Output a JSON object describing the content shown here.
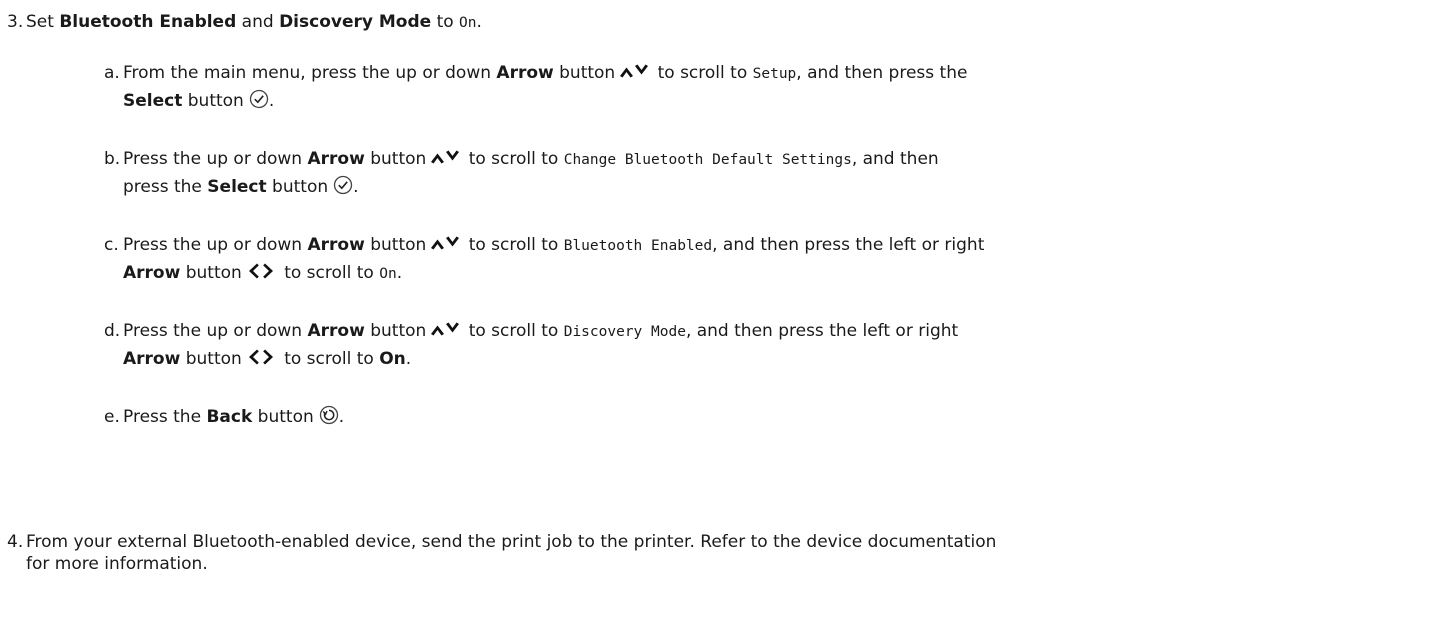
{
  "steps": [
    {
      "number": "3.",
      "t1": "Set ",
      "b1": "Bluetooth Enabled",
      "t2": " and ",
      "b2": "Discovery Mode",
      "t3": " to ",
      "code1": "On",
      "t4": ".",
      "substeps": [
        {
          "letter": "a.",
          "t1": "From the main menu, press the up or down ",
          "b1": "Arrow",
          "t2": " button",
          "t3": " to scroll to ",
          "code1": "Setup",
          "t4": ", and then press the",
          "b2": "Select",
          "t5": " button",
          "t6": "."
        },
        {
          "letter": "b.",
          "t1": "Press the up or down ",
          "b1": "Arrow",
          "t2": " button",
          "t3": " to scroll to ",
          "code1": "Change Bluetooth Default Settings",
          "t4": ", and then",
          "t5": "press the ",
          "b2": "Select",
          "t6": " button",
          "t7": "."
        },
        {
          "letter": "c.",
          "t1": "Press the up or down ",
          "b1": "Arrow",
          "t2": " button",
          "t3": " to scroll to ",
          "code1": "Bluetooth Enabled",
          "t4": ", and then press the left or right",
          "b2": "Arrow",
          "t5": " button",
          "t6": " to scroll to ",
          "code2": "On",
          "t7": "."
        },
        {
          "letter": "d.",
          "t1": "Press the up or down ",
          "b1": "Arrow",
          "t2": " button",
          "t3": " to scroll to ",
          "code1": "Discovery Mode",
          "t4": ", and then press the left or right",
          "b2": "Arrow",
          "t5": " button",
          "t6": " to scroll to ",
          "b3": "On",
          "t7": "."
        },
        {
          "letter": "e.",
          "t1": "Press the ",
          "b1": "Back",
          "t2": " button",
          "t3": "."
        }
      ]
    },
    {
      "number": "4.",
      "line1": "From your external Bluetooth-enabled device, send the print job to the printer. Refer to the device documentation",
      "line2": "for more information."
    }
  ],
  "icons": {
    "up_down_arrows": "up-down-arrow-buttons-icon",
    "left_right_arrows": "left-right-arrow-buttons-icon",
    "select": "select-button-icon",
    "back": "back-button-icon"
  }
}
